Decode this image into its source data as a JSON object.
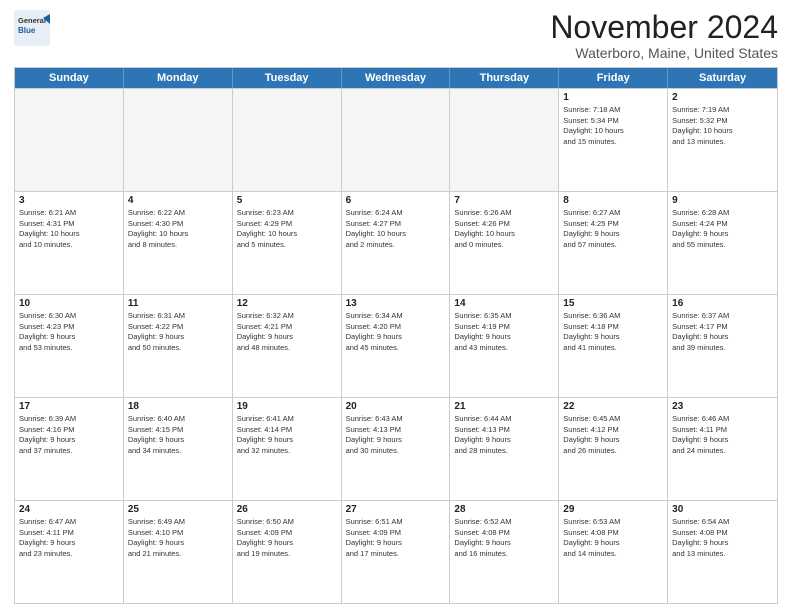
{
  "logo": {
    "general": "General",
    "blue": "Blue"
  },
  "title": "November 2024",
  "subtitle": "Waterboro, Maine, United States",
  "days_of_week": [
    "Sunday",
    "Monday",
    "Tuesday",
    "Wednesday",
    "Thursday",
    "Friday",
    "Saturday"
  ],
  "weeks": [
    [
      {
        "day": "",
        "empty": true
      },
      {
        "day": "",
        "empty": true
      },
      {
        "day": "",
        "empty": true
      },
      {
        "day": "",
        "empty": true
      },
      {
        "day": "",
        "empty": true
      },
      {
        "day": "1",
        "info": "Sunrise: 7:18 AM\nSunset: 5:34 PM\nDaylight: 10 hours\nand 15 minutes."
      },
      {
        "day": "2",
        "info": "Sunrise: 7:19 AM\nSunset: 5:32 PM\nDaylight: 10 hours\nand 13 minutes."
      }
    ],
    [
      {
        "day": "3",
        "info": "Sunrise: 6:21 AM\nSunset: 4:31 PM\nDaylight: 10 hours\nand 10 minutes."
      },
      {
        "day": "4",
        "info": "Sunrise: 6:22 AM\nSunset: 4:30 PM\nDaylight: 10 hours\nand 8 minutes."
      },
      {
        "day": "5",
        "info": "Sunrise: 6:23 AM\nSunset: 4:29 PM\nDaylight: 10 hours\nand 5 minutes."
      },
      {
        "day": "6",
        "info": "Sunrise: 6:24 AM\nSunset: 4:27 PM\nDaylight: 10 hours\nand 2 minutes."
      },
      {
        "day": "7",
        "info": "Sunrise: 6:26 AM\nSunset: 4:26 PM\nDaylight: 10 hours\nand 0 minutes."
      },
      {
        "day": "8",
        "info": "Sunrise: 6:27 AM\nSunset: 4:25 PM\nDaylight: 9 hours\nand 57 minutes."
      },
      {
        "day": "9",
        "info": "Sunrise: 6:28 AM\nSunset: 4:24 PM\nDaylight: 9 hours\nand 55 minutes."
      }
    ],
    [
      {
        "day": "10",
        "info": "Sunrise: 6:30 AM\nSunset: 4:23 PM\nDaylight: 9 hours\nand 53 minutes."
      },
      {
        "day": "11",
        "info": "Sunrise: 6:31 AM\nSunset: 4:22 PM\nDaylight: 9 hours\nand 50 minutes."
      },
      {
        "day": "12",
        "info": "Sunrise: 6:32 AM\nSunset: 4:21 PM\nDaylight: 9 hours\nand 48 minutes."
      },
      {
        "day": "13",
        "info": "Sunrise: 6:34 AM\nSunset: 4:20 PM\nDaylight: 9 hours\nand 45 minutes."
      },
      {
        "day": "14",
        "info": "Sunrise: 6:35 AM\nSunset: 4:19 PM\nDaylight: 9 hours\nand 43 minutes."
      },
      {
        "day": "15",
        "info": "Sunrise: 6:36 AM\nSunset: 4:18 PM\nDaylight: 9 hours\nand 41 minutes."
      },
      {
        "day": "16",
        "info": "Sunrise: 6:37 AM\nSunset: 4:17 PM\nDaylight: 9 hours\nand 39 minutes."
      }
    ],
    [
      {
        "day": "17",
        "info": "Sunrise: 6:39 AM\nSunset: 4:16 PM\nDaylight: 9 hours\nand 37 minutes."
      },
      {
        "day": "18",
        "info": "Sunrise: 6:40 AM\nSunset: 4:15 PM\nDaylight: 9 hours\nand 34 minutes."
      },
      {
        "day": "19",
        "info": "Sunrise: 6:41 AM\nSunset: 4:14 PM\nDaylight: 9 hours\nand 32 minutes."
      },
      {
        "day": "20",
        "info": "Sunrise: 6:43 AM\nSunset: 4:13 PM\nDaylight: 9 hours\nand 30 minutes."
      },
      {
        "day": "21",
        "info": "Sunrise: 6:44 AM\nSunset: 4:13 PM\nDaylight: 9 hours\nand 28 minutes."
      },
      {
        "day": "22",
        "info": "Sunrise: 6:45 AM\nSunset: 4:12 PM\nDaylight: 9 hours\nand 26 minutes."
      },
      {
        "day": "23",
        "info": "Sunrise: 6:46 AM\nSunset: 4:11 PM\nDaylight: 9 hours\nand 24 minutes."
      }
    ],
    [
      {
        "day": "24",
        "info": "Sunrise: 6:47 AM\nSunset: 4:11 PM\nDaylight: 9 hours\nand 23 minutes."
      },
      {
        "day": "25",
        "info": "Sunrise: 6:49 AM\nSunset: 4:10 PM\nDaylight: 9 hours\nand 21 minutes."
      },
      {
        "day": "26",
        "info": "Sunrise: 6:50 AM\nSunset: 4:09 PM\nDaylight: 9 hours\nand 19 minutes."
      },
      {
        "day": "27",
        "info": "Sunrise: 6:51 AM\nSunset: 4:09 PM\nDaylight: 9 hours\nand 17 minutes."
      },
      {
        "day": "28",
        "info": "Sunrise: 6:52 AM\nSunset: 4:08 PM\nDaylight: 9 hours\nand 16 minutes."
      },
      {
        "day": "29",
        "info": "Sunrise: 6:53 AM\nSunset: 4:08 PM\nDaylight: 9 hours\nand 14 minutes."
      },
      {
        "day": "30",
        "info": "Sunrise: 6:54 AM\nSunset: 4:08 PM\nDaylight: 9 hours\nand 13 minutes."
      }
    ]
  ]
}
